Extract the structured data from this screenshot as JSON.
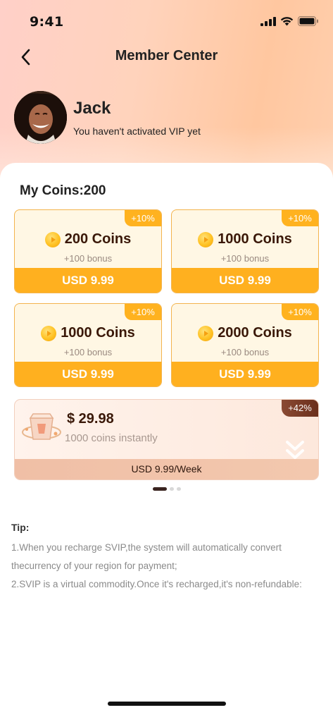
{
  "status_bar": {
    "time": "9:41"
  },
  "nav": {
    "title": "Member Center",
    "back_icon": "chevron-left-icon"
  },
  "profile": {
    "name": "Jack",
    "vip_status": "You haven't activated VIP yet"
  },
  "coins": {
    "label": "My Coins:200"
  },
  "packages": [
    {
      "badge": "+10%",
      "title": "200 Coins",
      "bonus": "+100 bonus",
      "price": "USD 9.99"
    },
    {
      "badge": "+10%",
      "title": "1000 Coins",
      "bonus": "+100 bonus",
      "price": "USD 9.99"
    },
    {
      "badge": "+10%",
      "title": "1000 Coins",
      "bonus": "+100 bonus",
      "price": "USD 9.99"
    },
    {
      "badge": "+10%",
      "title": "2000 Coins",
      "bonus": "+100 bonus",
      "price": "USD 9.99"
    }
  ],
  "weekly": {
    "badge": "+42%",
    "price": "$ 29.98",
    "desc": "1000 coins instantly",
    "bar": "USD 9.99/Week"
  },
  "pagination": {
    "current": 1,
    "total": 3
  },
  "tips": {
    "title": "Tip:",
    "lines": [
      "1.When you recharge SVIP,the system will automatically convert",
      "thecurrency of your region for payment;",
      "2.SVIP is a virtual commodity.Once it's recharged,it's non-refundable:"
    ]
  },
  "colors": {
    "accent": "#ffb01f",
    "badge_dark": "#6b2f1c",
    "title_brown": "#3a1808"
  }
}
